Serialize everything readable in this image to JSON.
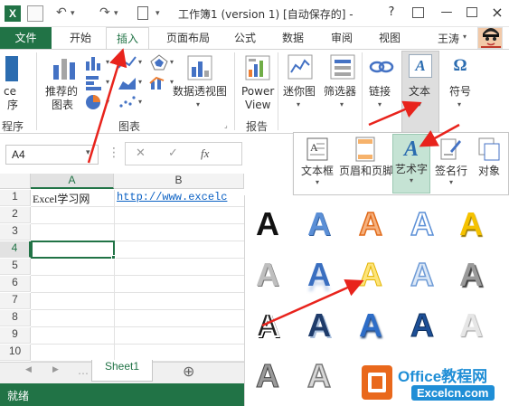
{
  "window": {
    "title": "工作簿1 (version 1) [自动保存的] -",
    "help_glyph": "?",
    "minimize_glyph": "—",
    "close_glyph": "×"
  },
  "tabs": {
    "file": "文件",
    "items": [
      "开始",
      "插入",
      "页面布局",
      "公式",
      "数据",
      "审阅",
      "视图"
    ],
    "user": "王涛"
  },
  "ribbon": {
    "cropped_left_line1": "ce",
    "cropped_left_line2": "序",
    "cropped_group": "程序",
    "recommended_chart_1": "推荐的",
    "recommended_chart_2": "图表",
    "pivot_chart": "数据透视图",
    "power_view_1": "Power",
    "power_view_2": "View",
    "sparkline": "迷你图",
    "filter": "筛选器",
    "link": "链接",
    "text": "文本",
    "symbol": "符号",
    "group_charts": "图表",
    "group_report": "报告"
  },
  "formula_bar": {
    "name_box": "A4",
    "cancel": "✕",
    "enter": "✓",
    "fx": "fx"
  },
  "grid": {
    "columns": [
      "A",
      "B"
    ],
    "rows": [
      "1",
      "2",
      "3",
      "4",
      "5",
      "6",
      "7",
      "8",
      "9",
      "10"
    ],
    "a1": "Excel学习网",
    "b1": "http://www.excelc"
  },
  "sheet": {
    "tab": "Sheet1",
    "add": "⊕",
    "status": "就绪"
  },
  "text_menu": {
    "textbox": "文本框",
    "header_footer": "页眉和页脚",
    "wordart": "艺术字",
    "signature": "签名行",
    "object": "对象"
  },
  "wordart_glyph": "A",
  "watermark": {
    "title": "Office教程网",
    "site": "Excelcn.com"
  },
  "colors": {
    "excel_green": "#217346",
    "selection_green": "#c5e3d4",
    "arrow_red": "#e8231c"
  }
}
